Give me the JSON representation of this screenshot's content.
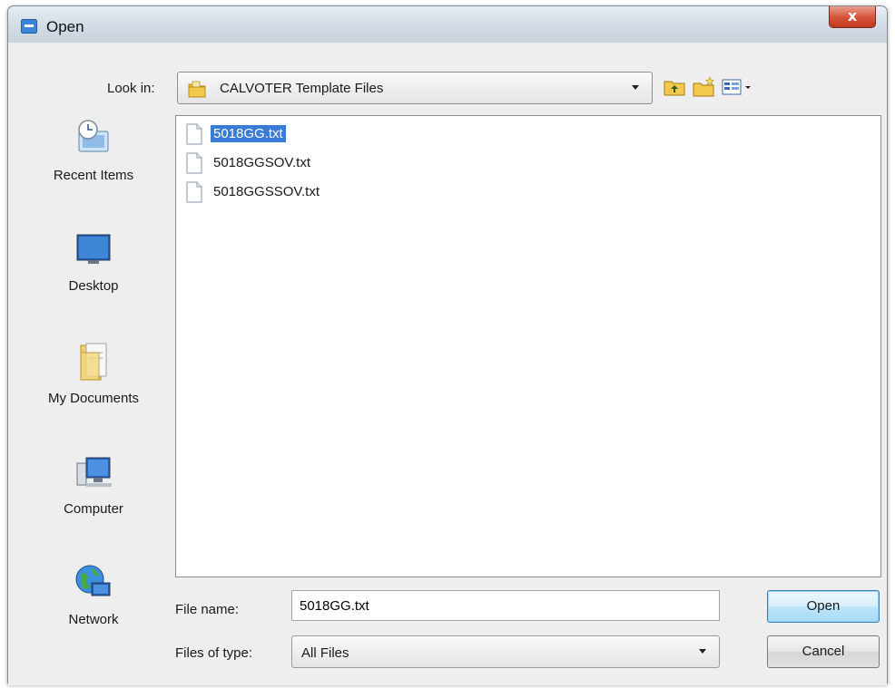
{
  "window": {
    "title": "Open",
    "close_label": "x"
  },
  "lookin": {
    "label": "Look in:",
    "value": "CALVOTER Template Files"
  },
  "toolbar": [
    "up-folder-icon",
    "new-folder-icon",
    "view-menu-icon"
  ],
  "places": [
    {
      "label": "Recent Items",
      "icon": "recent-items-icon"
    },
    {
      "label": "Desktop",
      "icon": "desktop-icon"
    },
    {
      "label": "My Documents",
      "icon": "my-documents-icon"
    },
    {
      "label": "Computer",
      "icon": "computer-icon"
    },
    {
      "label": "Network",
      "icon": "network-icon"
    }
  ],
  "files": [
    {
      "name": "5018GG.txt",
      "selected": true
    },
    {
      "name": "5018GGSOV.txt",
      "selected": false
    },
    {
      "name": "5018GGSSOV.txt",
      "selected": false
    }
  ],
  "filename": {
    "label": "File name:",
    "value": "5018GG.txt"
  },
  "filetype": {
    "label": "Files of type:",
    "value": "All Files"
  },
  "buttons": {
    "open": "Open",
    "cancel": "Cancel"
  },
  "colors": {
    "selection": "#3a7bd5",
    "close": "#c1381e",
    "default_button": "#bee6fd"
  }
}
